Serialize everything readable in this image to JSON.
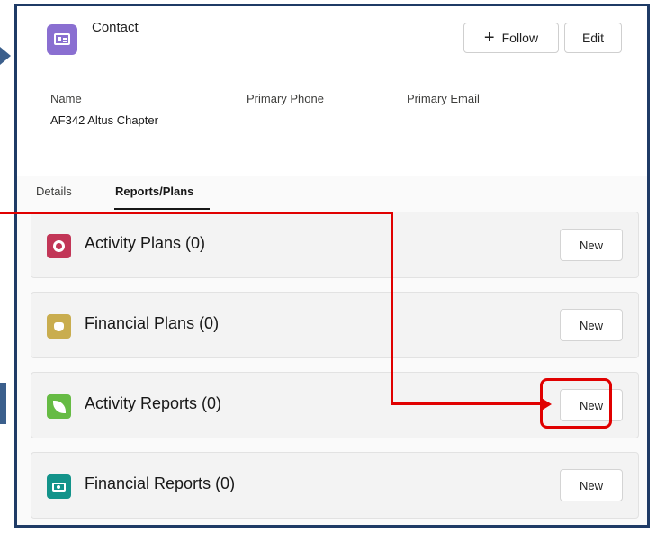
{
  "record": {
    "type_label": "Contact",
    "follow_label": "Follow",
    "edit_label": "Edit"
  },
  "fields": {
    "name_label": "Name",
    "name_value": "AF342 Altus Chapter",
    "phone_label": "Primary Phone",
    "email_label": "Primary Email"
  },
  "tabs": [
    {
      "label": "Details"
    },
    {
      "label": "Reports/Plans",
      "active": true
    }
  ],
  "related_lists": [
    {
      "title": "Activity Plans (0)",
      "icon": "activity-plan-icon",
      "color": "#c23657",
      "new_label": "New"
    },
    {
      "title": "Financial Plans (0)",
      "icon": "financial-plan-icon",
      "color": "#c9ad4f",
      "new_label": "New"
    },
    {
      "title": "Activity Reports (0)",
      "icon": "activity-report-icon",
      "color": "#66bb44",
      "new_label": "New"
    },
    {
      "title": "Financial Reports (0)",
      "icon": "financial-report-icon",
      "color": "#13938a",
      "new_label": "New"
    }
  ],
  "colors": {
    "annotation": "#e00000",
    "frame": "#1f3b66",
    "record_icon": "#8a6fd1"
  }
}
